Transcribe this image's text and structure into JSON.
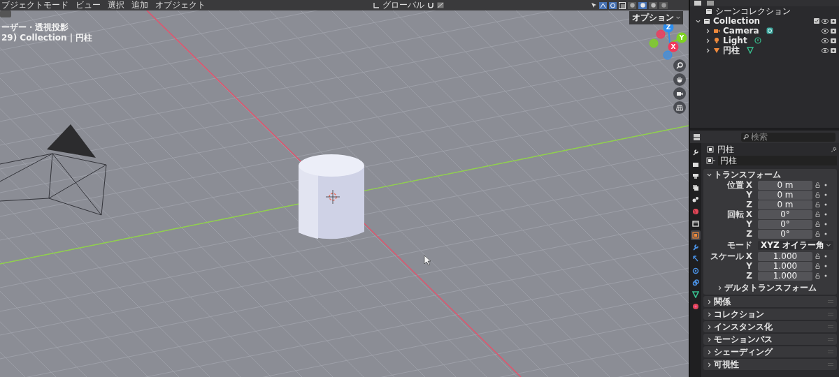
{
  "viewport": {
    "header": {
      "menu": [
        "ブジェクトモード",
        "ビュー",
        "選択",
        "追加",
        "オブジェクト"
      ],
      "orientation": "グローバル",
      "shading_modes": [
        {
          "kind": "wire",
          "selected": false
        },
        {
          "kind": "solid",
          "selected": true
        },
        {
          "kind": "material",
          "selected": false
        },
        {
          "kind": "render",
          "selected": false
        }
      ]
    },
    "view_name": "ーザー・透視投影",
    "collection_info": "29) Collection | 円柱",
    "options_label": "オプション",
    "gizmo_axes": [
      {
        "label": "Z",
        "color": "#2e8ff0"
      },
      {
        "label": "Y",
        "color": "#7ed321"
      },
      {
        "label": "X",
        "color": "#f2385a"
      }
    ]
  },
  "outliner": {
    "root": "シーンコレクション",
    "items": [
      {
        "label": "Collection",
        "kind": "collection",
        "expanded": true,
        "children": [
          {
            "label": "Camera",
            "kind": "camera",
            "expanded": false
          },
          {
            "label": "Light",
            "kind": "light",
            "expanded": false
          },
          {
            "label": "円柱",
            "kind": "mesh",
            "expanded": false
          }
        ]
      }
    ]
  },
  "properties": {
    "search": {
      "placeholder": "検索"
    },
    "context_title": "円柱",
    "object_name": "円柱",
    "tabs": [
      {
        "kind": "tool",
        "selected": false
      },
      {
        "kind": "render",
        "selected": false
      },
      {
        "kind": "output",
        "selected": false
      },
      {
        "kind": "view_layer",
        "selected": false
      },
      {
        "kind": "scene",
        "selected": false
      },
      {
        "kind": "world",
        "selected": false
      },
      {
        "kind": "collection",
        "selected": false
      },
      {
        "kind": "object",
        "selected": true
      },
      {
        "kind": "modifier",
        "selected": false
      },
      {
        "kind": "particles",
        "selected": false
      },
      {
        "kind": "physics",
        "selected": false
      },
      {
        "kind": "constraints",
        "selected": false
      },
      {
        "kind": "data",
        "selected": false
      },
      {
        "kind": "material",
        "selected": false
      }
    ],
    "transform": {
      "label": "トランスフォーム",
      "expanded": true,
      "rows": [
        {
          "kind": "field",
          "label": "位置",
          "axis": "X",
          "value": "0 m"
        },
        {
          "kind": "field",
          "axis": "Y",
          "value": "0 m"
        },
        {
          "kind": "field",
          "axis": "Z",
          "value": "0 m"
        },
        {
          "kind": "field",
          "label": "回転",
          "axis": "X",
          "value": "0°"
        },
        {
          "kind": "field",
          "axis": "Y",
          "value": "0°"
        },
        {
          "kind": "field",
          "axis": "Z",
          "value": "0°"
        },
        {
          "kind": "select",
          "label": "モード",
          "value": "XYZ オイラー角"
        },
        {
          "kind": "field",
          "label": "スケール",
          "axis": "X",
          "value": "1.000"
        },
        {
          "kind": "field",
          "axis": "Y",
          "value": "1.000"
        },
        {
          "kind": "field",
          "axis": "Z",
          "value": "1.000"
        }
      ],
      "subpanel": {
        "label": "デルタトランスフォーム",
        "expanded": false
      }
    },
    "panels": [
      {
        "label": "関係",
        "expanded": false
      },
      {
        "label": "コレクション",
        "expanded": false
      },
      {
        "label": "インスタンス化",
        "expanded": false
      },
      {
        "label": "モーションパス",
        "expanded": false
      },
      {
        "label": "シェーディング",
        "expanded": false
      },
      {
        "label": "可視性",
        "expanded": false
      }
    ]
  }
}
